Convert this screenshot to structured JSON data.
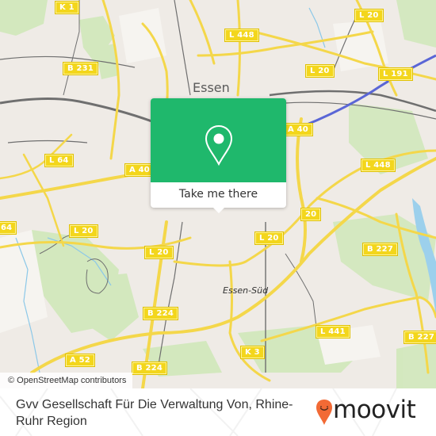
{
  "map": {
    "city_label": "Essen",
    "district_label": "Essen-Süd",
    "road_labels": [
      {
        "id": "k1",
        "text": "K 1"
      },
      {
        "id": "b231",
        "text": "B 231"
      },
      {
        "id": "l448-top",
        "text": "L 448"
      },
      {
        "id": "l20-top-right",
        "text": "L 20"
      },
      {
        "id": "l20-right",
        "text": "L 20"
      },
      {
        "id": "l191",
        "text": "L 191"
      },
      {
        "id": "a40-right",
        "text": "A 40"
      },
      {
        "id": "l448-right",
        "text": "L 448"
      },
      {
        "id": "l64",
        "text": "L 64"
      },
      {
        "id": "a40-left",
        "text": "A 40"
      },
      {
        "id": "l64-left",
        "text": "64"
      },
      {
        "id": "l20-left",
        "text": "L 20"
      },
      {
        "id": "l20-center",
        "text": "L 20"
      },
      {
        "id": "l20-mid",
        "text": "L 20"
      },
      {
        "id": "l20-partial",
        "text": "20"
      },
      {
        "id": "b227-top",
        "text": "B 227"
      },
      {
        "id": "b224-mid",
        "text": "B 224"
      },
      {
        "id": "l441",
        "text": "L 441"
      },
      {
        "id": "b227-right",
        "text": "B 227"
      },
      {
        "id": "k3",
        "text": "K 3"
      },
      {
        "id": "a52",
        "text": "A 52"
      },
      {
        "id": "b224-bottom",
        "text": "B 224"
      }
    ],
    "attribution": "© OpenStreetMap contributors"
  },
  "popup": {
    "icon": "map-pin-icon",
    "cta_label": "Take me there",
    "color": "#1fb86c"
  },
  "footer": {
    "place_name": "Gvv Gesellschaft Für Die Verwaltung Von, Rhine-Ruhr Region",
    "brand": "moovit",
    "brand_icon": "moovit-pin-icon",
    "brand_color": "#f26a35"
  }
}
